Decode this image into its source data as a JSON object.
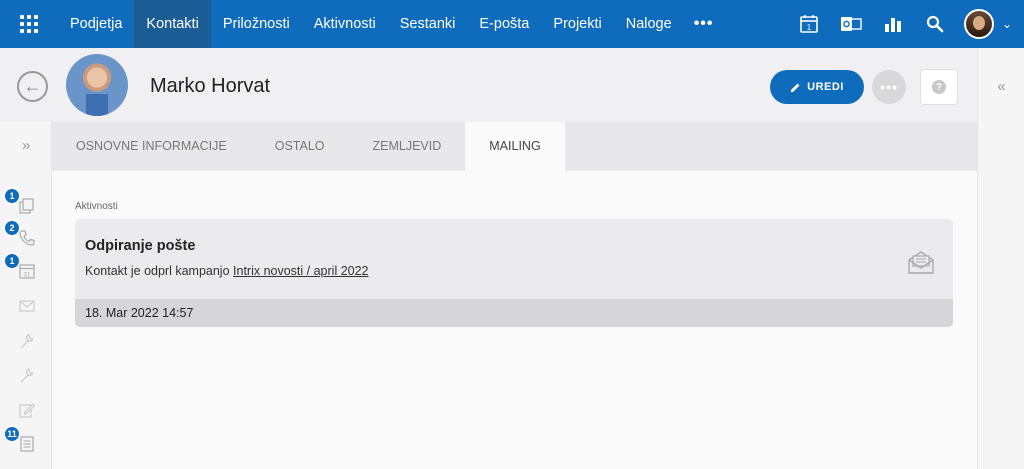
{
  "topnav": {
    "items": [
      "Podjetja",
      "Kontakti",
      "Priložnosti",
      "Aktivnosti",
      "Sestanki",
      "E-pošta",
      "Projekti",
      "Naloge"
    ],
    "active": "Kontakti",
    "more": "•••",
    "calendar_day": "1"
  },
  "header": {
    "contact_name": "Marko Horvat",
    "edit_label": "UREDI",
    "more_label": "•••",
    "help_label": "?"
  },
  "tabs": [
    "OSNOVNE INFORMACIJE",
    "OSTALO",
    "ZEMLJEVID",
    "MAILING"
  ],
  "active_tab": "MAILING",
  "rail_badges": {
    "documents": "1",
    "calls": "2",
    "calendar": "1",
    "notes": "11"
  },
  "calendar_icon_text": "31",
  "main": {
    "section_label": "Aktivnosti",
    "activity": {
      "title": "Odpiranje pošte",
      "desc_prefix": "Kontakt je odprl kampanjo ",
      "campaign_link": "Intrix novosti / april 2022",
      "date": "18. Mar 2022 14:57"
    }
  },
  "colors": {
    "brand": "#0f6cbd",
    "nav_active": "#1d5d95"
  }
}
